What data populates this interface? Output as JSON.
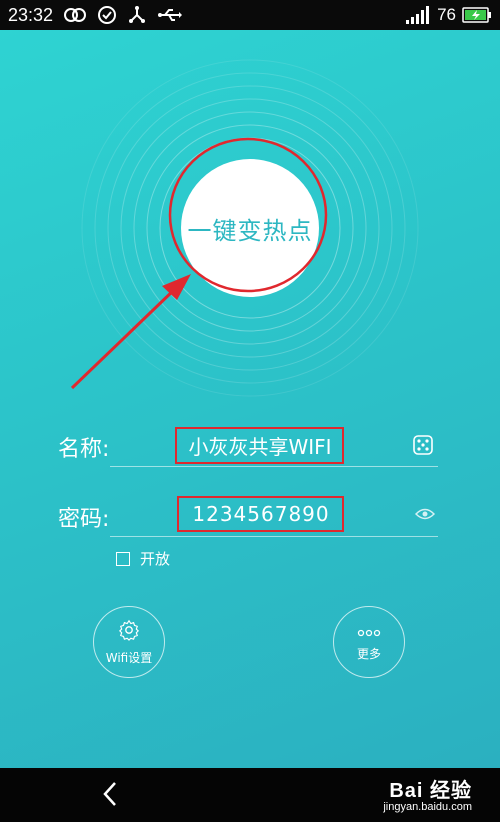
{
  "status_bar": {
    "time": "23:32",
    "battery_level": "76",
    "icons": [
      "dual-ring-icon",
      "check-circle-icon",
      "share-nodes-icon",
      "usb-icon"
    ],
    "signal_icon": "signal-bars-icon",
    "battery_icon": "battery-charging-icon"
  },
  "hotspot": {
    "button_label": "一键变热点"
  },
  "form": {
    "name_label": "名称:",
    "name_value": "小灰灰共享WIFI",
    "name_side_icon": "dice-icon",
    "password_label": "密码:",
    "password_value": "1234567890",
    "password_side_icon": "eye-icon",
    "open_label": "开放",
    "open_checked": false
  },
  "actions": {
    "wifi_settings_label": "Wifi设置",
    "wifi_settings_icon": "gear-icon",
    "more_label": "更多",
    "more_icon": "dots-icon"
  },
  "nav": {
    "back_icon": "chevron-left-icon"
  },
  "watermark": {
    "brand": "Bai  经验",
    "url": "jingyan.baidu.com"
  },
  "colors": {
    "accent": "#2db7c2",
    "annotation_red": "#e0282e",
    "gradient_start": "#2ed3d2",
    "gradient_end": "#2bb0c0"
  }
}
